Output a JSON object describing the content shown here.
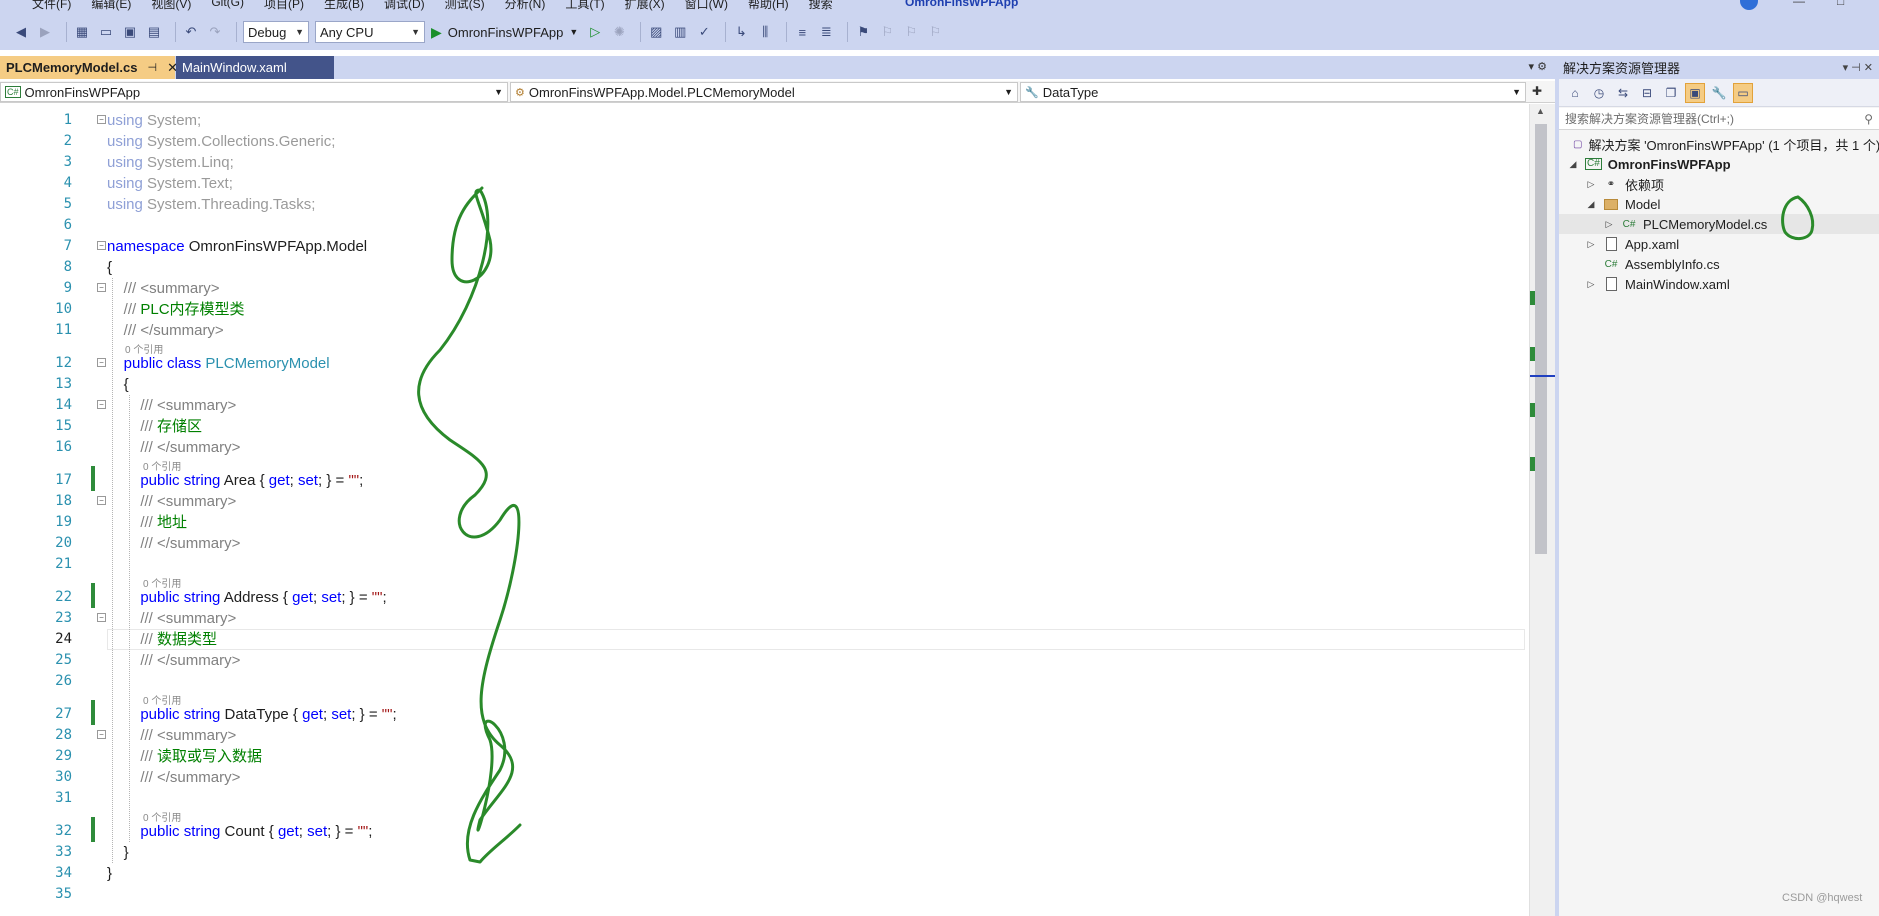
{
  "menubar": {
    "items": [
      "文件(F)",
      "编辑(E)",
      "视图(V)",
      "Git(G)",
      "项目(P)",
      "生成(B)",
      "调试(D)",
      "测试(S)",
      "分析(N)",
      "工具(T)",
      "扩展(X)",
      "窗口(W)",
      "帮助(H)",
      "搜索"
    ],
    "app_name": "OmronFinsWPFApp"
  },
  "toolbar": {
    "config": "Debug",
    "platform": "Any CPU",
    "run_label": "OmronFinsWPFApp"
  },
  "tabs": [
    {
      "label": "PLCMemoryModel.cs",
      "active": true
    },
    {
      "label": "MainWindow.xaml",
      "active": false
    }
  ],
  "navbar": {
    "project": "OmronFinsWPFApp",
    "type": "OmronFinsWPFApp.Model.PLCMemoryModel",
    "member": "DataType"
  },
  "editor": {
    "current_line": 24,
    "codelens_label": "0 个引用",
    "lines": [
      {
        "n": "1",
        "tokens": [
          [
            "kw-using",
            "using"
          ],
          [
            "gray",
            " System;"
          ]
        ]
      },
      {
        "n": "2",
        "tokens": [
          [
            "kw-using",
            "using"
          ],
          [
            "gray",
            " System.Collections.Generic;"
          ]
        ]
      },
      {
        "n": "3",
        "tokens": [
          [
            "kw-using",
            "using"
          ],
          [
            "gray",
            " System.Linq;"
          ]
        ]
      },
      {
        "n": "4",
        "tokens": [
          [
            "kw-using",
            "using"
          ],
          [
            "gray",
            " System.Text;"
          ]
        ]
      },
      {
        "n": "5",
        "tokens": [
          [
            "kw-using",
            "using"
          ],
          [
            "gray",
            " System.Threading.Tasks;"
          ]
        ]
      },
      {
        "n": "6",
        "tokens": []
      },
      {
        "n": "7",
        "tokens": [
          [
            "kw",
            "namespace"
          ],
          [
            "plain",
            " OmronFinsWPFApp.Model"
          ]
        ]
      },
      {
        "n": "8",
        "tokens": [
          [
            "plain",
            "{"
          ]
        ]
      },
      {
        "n": "9",
        "tokens": [
          [
            "cmt",
            "    /// <summary>"
          ]
        ]
      },
      {
        "n": "10",
        "tokens": [
          [
            "cmt",
            "    ///"
          ],
          [
            "cmtg",
            " PLC内存模型类"
          ]
        ]
      },
      {
        "n": "11",
        "tokens": [
          [
            "cmt",
            "    /// </summary>"
          ]
        ]
      },
      {
        "n": "12",
        "tokens": [
          [
            "kw",
            "    public class"
          ],
          [
            "type",
            " PLCMemoryModel"
          ]
        ]
      },
      {
        "n": "13",
        "tokens": [
          [
            "plain",
            "    {"
          ]
        ]
      },
      {
        "n": "14",
        "tokens": [
          [
            "cmt",
            "        /// <summary>"
          ]
        ]
      },
      {
        "n": "15",
        "tokens": [
          [
            "cmt",
            "        ///"
          ],
          [
            "cmtg",
            " 存储区"
          ]
        ]
      },
      {
        "n": "16",
        "tokens": [
          [
            "cmt",
            "        /// </summary>"
          ]
        ]
      },
      {
        "n": "17",
        "tokens": [
          [
            "kw",
            "        public string"
          ],
          [
            "plain",
            " Area { "
          ],
          [
            "kw",
            "get"
          ],
          [
            "plain",
            "; "
          ],
          [
            "kw",
            "set"
          ],
          [
            "plain",
            "; } = "
          ],
          [
            "str",
            "\"\""
          ],
          [
            "plain",
            ";"
          ]
        ]
      },
      {
        "n": "18",
        "tokens": [
          [
            "cmt",
            "        /// <summary>"
          ]
        ]
      },
      {
        "n": "19",
        "tokens": [
          [
            "cmt",
            "        ///"
          ],
          [
            "cmtg",
            " 地址"
          ]
        ]
      },
      {
        "n": "20",
        "tokens": [
          [
            "cmt",
            "        /// </summary>"
          ]
        ]
      },
      {
        "n": "21",
        "tokens": []
      },
      {
        "n": "22",
        "tokens": [
          [
            "kw",
            "        public string"
          ],
          [
            "plain",
            " Address { "
          ],
          [
            "kw",
            "get"
          ],
          [
            "plain",
            "; "
          ],
          [
            "kw",
            "set"
          ],
          [
            "plain",
            "; } = "
          ],
          [
            "str",
            "\"\""
          ],
          [
            "plain",
            ";"
          ]
        ]
      },
      {
        "n": "23",
        "tokens": [
          [
            "cmt",
            "        /// <summary>"
          ]
        ]
      },
      {
        "n": "24",
        "tokens": [
          [
            "cmt",
            "        ///"
          ],
          [
            "cmtg",
            " 数据类型"
          ]
        ]
      },
      {
        "n": "25",
        "tokens": [
          [
            "cmt",
            "        /// </summary>"
          ]
        ]
      },
      {
        "n": "26",
        "tokens": []
      },
      {
        "n": "27",
        "tokens": [
          [
            "kw",
            "        public string"
          ],
          [
            "plain",
            " DataType { "
          ],
          [
            "kw",
            "get"
          ],
          [
            "plain",
            "; "
          ],
          [
            "kw",
            "set"
          ],
          [
            "plain",
            "; } = "
          ],
          [
            "str",
            "\"\""
          ],
          [
            "plain",
            ";"
          ]
        ]
      },
      {
        "n": "28",
        "tokens": [
          [
            "cmt",
            "        /// <summary>"
          ]
        ]
      },
      {
        "n": "29",
        "tokens": [
          [
            "cmt",
            "        ///"
          ],
          [
            "cmtg",
            " 读取或写入数据"
          ]
        ]
      },
      {
        "n": "30",
        "tokens": [
          [
            "cmt",
            "        /// </summary>"
          ]
        ]
      },
      {
        "n": "31",
        "tokens": []
      },
      {
        "n": "32",
        "tokens": [
          [
            "kw",
            "        public string"
          ],
          [
            "plain",
            " Count { "
          ],
          [
            "kw",
            "get"
          ],
          [
            "plain",
            "; "
          ],
          [
            "kw",
            "set"
          ],
          [
            "plain",
            "; } = "
          ],
          [
            "str",
            "\"\""
          ],
          [
            "plain",
            ";"
          ]
        ]
      },
      {
        "n": "33",
        "tokens": [
          [
            "plain",
            "    }"
          ]
        ]
      },
      {
        "n": "34",
        "tokens": [
          [
            "plain",
            "}"
          ]
        ]
      },
      {
        "n": "35",
        "tokens": []
      }
    ]
  },
  "solution_explorer": {
    "title": "解决方案资源管理器",
    "search_placeholder": "搜索解决方案资源管理器(Ctrl+;)",
    "nodes": [
      {
        "label": "解决方案 'OmronFinsWPFApp' (1 个项目，共 1 个)",
        "icon": "solution-icon"
      },
      {
        "label": "OmronFinsWPFApp",
        "icon": "csharp-project-icon"
      },
      {
        "label": "依赖项",
        "icon": "dependencies-icon"
      },
      {
        "label": "Model",
        "icon": "folder-icon"
      },
      {
        "label": "PLCMemoryModel.cs",
        "icon": "csharp-file-icon"
      },
      {
        "label": "App.xaml",
        "icon": "xaml-file-icon"
      },
      {
        "label": "AssemblyInfo.cs",
        "icon": "csharp-file-icon"
      },
      {
        "label": "MainWindow.xaml",
        "icon": "xaml-file-icon"
      }
    ]
  },
  "watermark": "CSDN @hqwest",
  "colors": {
    "chrome": "#ccd5f0",
    "active_tab": "#f5cc84",
    "inactive_tab": "#43548a",
    "keyword": "#0000ff",
    "type": "#2b91af",
    "comment": "#008000",
    "string": "#a31515",
    "change_bar": "#2e8b3a",
    "ink": "#2a8a2a"
  }
}
